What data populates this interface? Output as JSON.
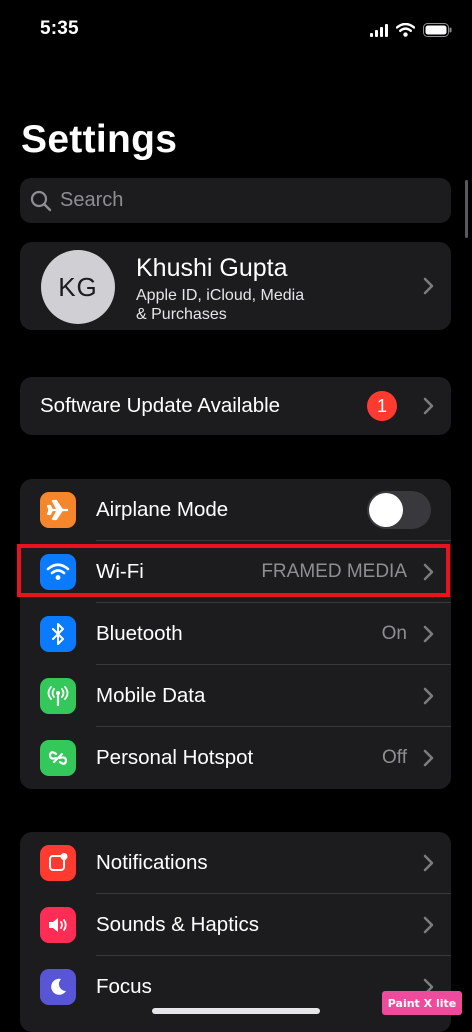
{
  "status_bar": {
    "time": "5:35"
  },
  "header": {
    "title": "Settings"
  },
  "search": {
    "placeholder": "Search"
  },
  "profile": {
    "initials": "KG",
    "name": "Khushi Gupta",
    "subtitle_line1": "Apple ID, iCloud, Media",
    "subtitle_line2": "& Purchases"
  },
  "software_update": {
    "label": "Software Update Available",
    "badge": "1"
  },
  "connectivity": {
    "items": [
      {
        "label": "Airplane Mode",
        "icon": "airplane-icon",
        "color": "#f5862c",
        "toggle_on": false
      },
      {
        "label": "Wi-Fi",
        "icon": "wifi-icon",
        "color": "#0a7aff",
        "value": "FRAMED MEDIA"
      },
      {
        "label": "Bluetooth",
        "icon": "bluetooth-icon",
        "color": "#0a7aff",
        "value": "On"
      },
      {
        "label": "Mobile Data",
        "icon": "antenna-icon",
        "color": "#34c759",
        "value": ""
      },
      {
        "label": "Personal Hotspot",
        "icon": "hotspot-icon",
        "color": "#34c759",
        "value": "Off"
      }
    ]
  },
  "notifications_group": {
    "items": [
      {
        "label": "Notifications",
        "icon": "bell-icon",
        "color": "#ff3b30"
      },
      {
        "label": "Sounds & Haptics",
        "icon": "speaker-icon",
        "color": "#ff2d55"
      },
      {
        "label": "Focus",
        "icon": "moon-icon",
        "color": "#5856d6"
      }
    ]
  },
  "watermark": {
    "text": "Paint X lite"
  },
  "colors": {
    "background": "#000000",
    "cell": "#1c1c1e",
    "highlight": "#e8131c",
    "badge": "#ff3b30"
  }
}
